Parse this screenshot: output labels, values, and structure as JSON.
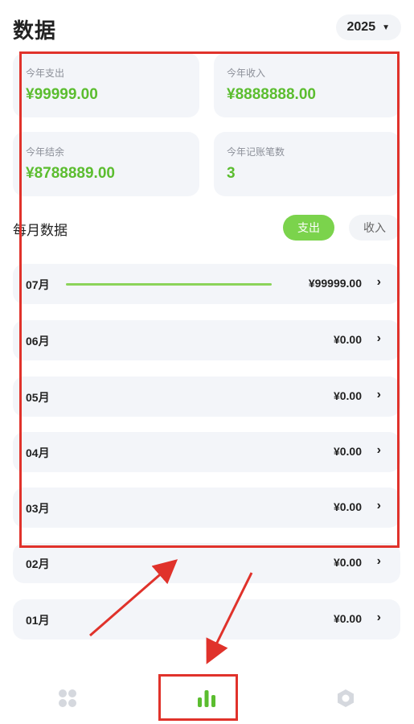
{
  "header": {
    "title": "数据",
    "year": "2025"
  },
  "stats": {
    "year_expense": {
      "label": "今年支出",
      "value": "¥99999.00"
    },
    "year_income": {
      "label": "今年收入",
      "value": "¥8888888.00"
    },
    "year_balance": {
      "label": "今年结余",
      "value": "¥8788889.00"
    },
    "year_count": {
      "label": "今年记账笔数",
      "value": "3"
    }
  },
  "monthly": {
    "title": "每月数据",
    "toggle": {
      "expense": "支出",
      "income": "收入",
      "active": "expense"
    },
    "months": [
      {
        "label": "07月",
        "amount": "¥99999.00",
        "share": 1.0
      },
      {
        "label": "06月",
        "amount": "¥0.00",
        "share": 0
      },
      {
        "label": "05月",
        "amount": "¥0.00",
        "share": 0
      },
      {
        "label": "04月",
        "amount": "¥0.00",
        "share": 0
      },
      {
        "label": "03月",
        "amount": "¥0.00",
        "share": 0
      },
      {
        "label": "02月",
        "amount": "¥0.00",
        "share": 0
      },
      {
        "label": "01月",
        "amount": "¥0.00",
        "share": 0
      }
    ]
  },
  "tabbar": {
    "items": [
      {
        "icon": "grid-icon",
        "active": false
      },
      {
        "icon": "bar-chart-icon",
        "active": true
      },
      {
        "icon": "settings-hexagon-icon",
        "active": false
      }
    ]
  },
  "colors": {
    "accent": "#7bd34c",
    "value_green": "#5bbd2f",
    "card_bg": "#f3f5f9",
    "annotation": "#e0322b"
  }
}
